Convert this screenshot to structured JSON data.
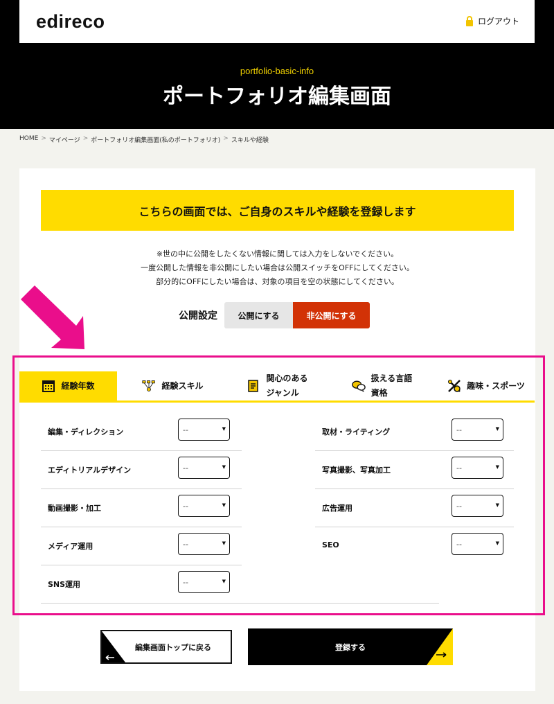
{
  "header": {
    "logo_text": "edireco",
    "logout_label": "ログアウト",
    "hero_subtitle": "portfolio-basic-info",
    "hero_title": "ポートフォリオ編集画面"
  },
  "breadcrumb": [
    "HOME",
    "マイページ",
    "ポートフォリオ編集画面(私のポートフォリオ)",
    "スキルや経験"
  ],
  "banner_text": "こちらの画面では、ご自身のスキルや経験を登録します",
  "notes": [
    "※世の中に公開をしたくない情報に関しては入力をしないでください。",
    "一度公開した情報を非公開にしたい場合は公開スイッチをOFFにしてください。",
    "部分的にOFFにしたい場合は、対象の項目を空の状態にしてください。"
  ],
  "privacy": {
    "label": "公開設定",
    "public_label": "公開にする",
    "private_label": "非公開にする",
    "selected": "非公開にする"
  },
  "tabs": [
    {
      "label": "経験年数",
      "icon": "calendar-icon",
      "active": true
    },
    {
      "label": "経験スキル",
      "icon": "skills-icon",
      "active": false
    },
    {
      "label": "関心のある\nジャンル",
      "icon": "document-icon",
      "active": false
    },
    {
      "label": "扱える言語\n資格",
      "icon": "speech-bubble-icon",
      "active": false
    },
    {
      "label": "趣味・スポーツ",
      "icon": "hobby-icon",
      "active": false
    }
  ],
  "fields_left": [
    {
      "label": "編集・ディレクション",
      "value": "--"
    },
    {
      "label": "エディトリアルデザイン",
      "value": "--"
    },
    {
      "label": "動画撮影・加工",
      "value": "--"
    },
    {
      "label": "メディア運用",
      "value": "--"
    },
    {
      "label": "SNS運用",
      "value": "--"
    }
  ],
  "fields_right": [
    {
      "label": "取材・ライティング",
      "value": "--"
    },
    {
      "label": "写真撮影、写真加工",
      "value": "--"
    },
    {
      "label": "広告運用",
      "value": "--"
    },
    {
      "label": "SEO",
      "value": "--"
    }
  ],
  "actions": {
    "back_label": "編集画面トップに戻る",
    "submit_label": "登録する"
  },
  "colors": {
    "accent_yellow": "#ffdc00",
    "private_red": "#d23206",
    "highlight_pink": "#ea0e8b"
  }
}
